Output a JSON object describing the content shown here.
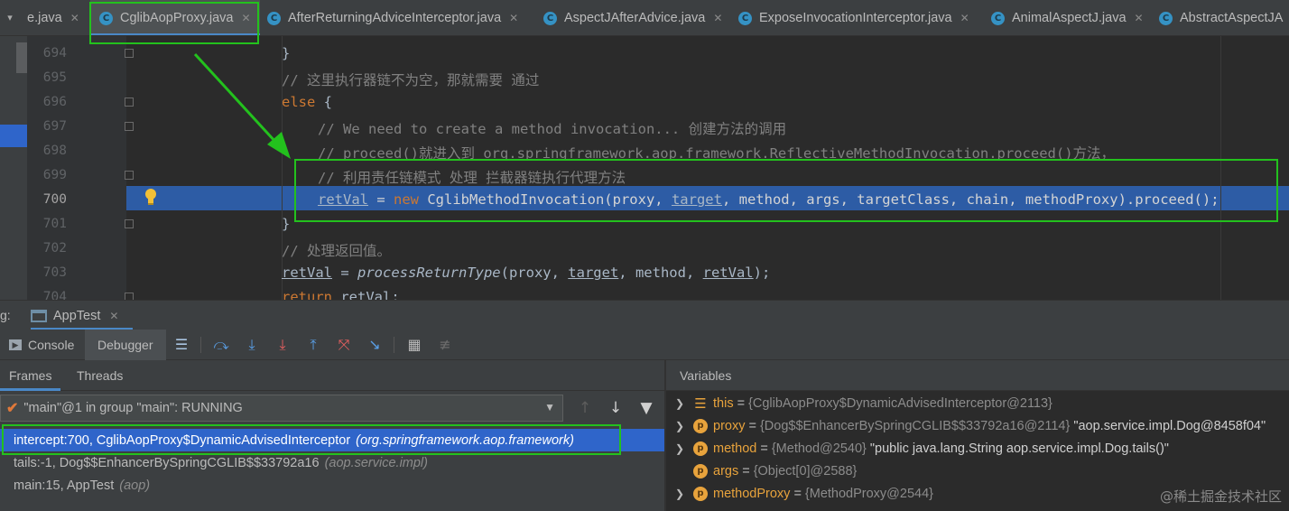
{
  "tabs": [
    {
      "label": "e.java"
    },
    {
      "label": "CglibAopProxy.java",
      "active": true
    },
    {
      "label": "AfterReturningAdviceInterceptor.java"
    },
    {
      "label": "AspectJAfterAdvice.java"
    },
    {
      "label": "ExposeInvocationInterceptor.java"
    },
    {
      "label": "AnimalAspectJ.java"
    },
    {
      "label": "AbstractAspectJA"
    }
  ],
  "editor": {
    "line_numbers": [
      "694",
      "695",
      "696",
      "697",
      "698",
      "699",
      "700",
      "701",
      "702",
      "703",
      "704"
    ],
    "current_line": "700",
    "lines": {
      "l694": "}",
      "l695": "// 这里执行器链不为空，那就需要 通过",
      "l696_kw": "else",
      "l696_rest": " {",
      "l697": "// We need to create a method invocation... 创建方法的调用",
      "l698": "// proceed()就进入到 org.springframework.aop.framework.ReflectiveMethodInvocation.proceed()方法，",
      "l699": "// 利用责任链模式 处理 拦截器链执行代理方法",
      "l700_var": "retVal",
      "l700_eq": " = ",
      "l700_new": "new",
      "l700_call": " CglibMethodInvocation(proxy, ",
      "l700_target": "target",
      "l700_rest": ", method, args, targetClass, chain, methodProxy).proceed();",
      "l701": "}",
      "l702": "// 处理返回值。",
      "l703_var": "retVal",
      "l703_eq": " = ",
      "l703_fn": "processReturnType",
      "l703_args1": "(proxy, ",
      "l703_target": "target",
      "l703_args2": ", method, ",
      "l703_var2": "retVal",
      "l703_end": ");",
      "l704_kw": "return",
      "l704_rest": " retVal;"
    }
  },
  "debug": {
    "title_label": "g:",
    "run_tab": "AppTest",
    "toolbar": {
      "console": "Console",
      "debugger": "Debugger"
    },
    "frames_tab": "Frames",
    "threads_tab": "Threads",
    "thread_select": "\"main\"@1 in group \"main\": RUNNING",
    "frames": [
      {
        "method": "intercept:700, CglibAopProxy$DynamicAdvisedInterceptor",
        "pkg": "(org.springframework.aop.framework)"
      },
      {
        "method": "tails:-1, Dog$$EnhancerBySpringCGLIB$$33792a16",
        "pkg": "(aop.service.impl)"
      },
      {
        "method": "main:15, AppTest",
        "pkg": "(aop)"
      }
    ],
    "variables_title": "Variables",
    "variables": [
      {
        "name": "this",
        "type": "{CglibAopProxy$DynamicAdvisedInterceptor@2113}",
        "value": ""
      },
      {
        "name": "proxy",
        "type": "{Dog$$EnhancerBySpringCGLIB$$33792a16@2114}",
        "value": "\"aop.service.impl.Dog@8458f04\""
      },
      {
        "name": "method",
        "type": "{Method@2540}",
        "value": "\"public java.lang.String aop.service.impl.Dog.tails()\""
      },
      {
        "name": "args",
        "type": "{Object[0]@2588}",
        "value": ""
      },
      {
        "name": "methodProxy",
        "type": "{MethodProxy@2544}",
        "value": ""
      }
    ]
  },
  "watermark": "@稀土掘金技术社区",
  "colors": {
    "accent": "#4a88c7",
    "selection": "#2f65ca",
    "annotation": "#23c11d"
  }
}
